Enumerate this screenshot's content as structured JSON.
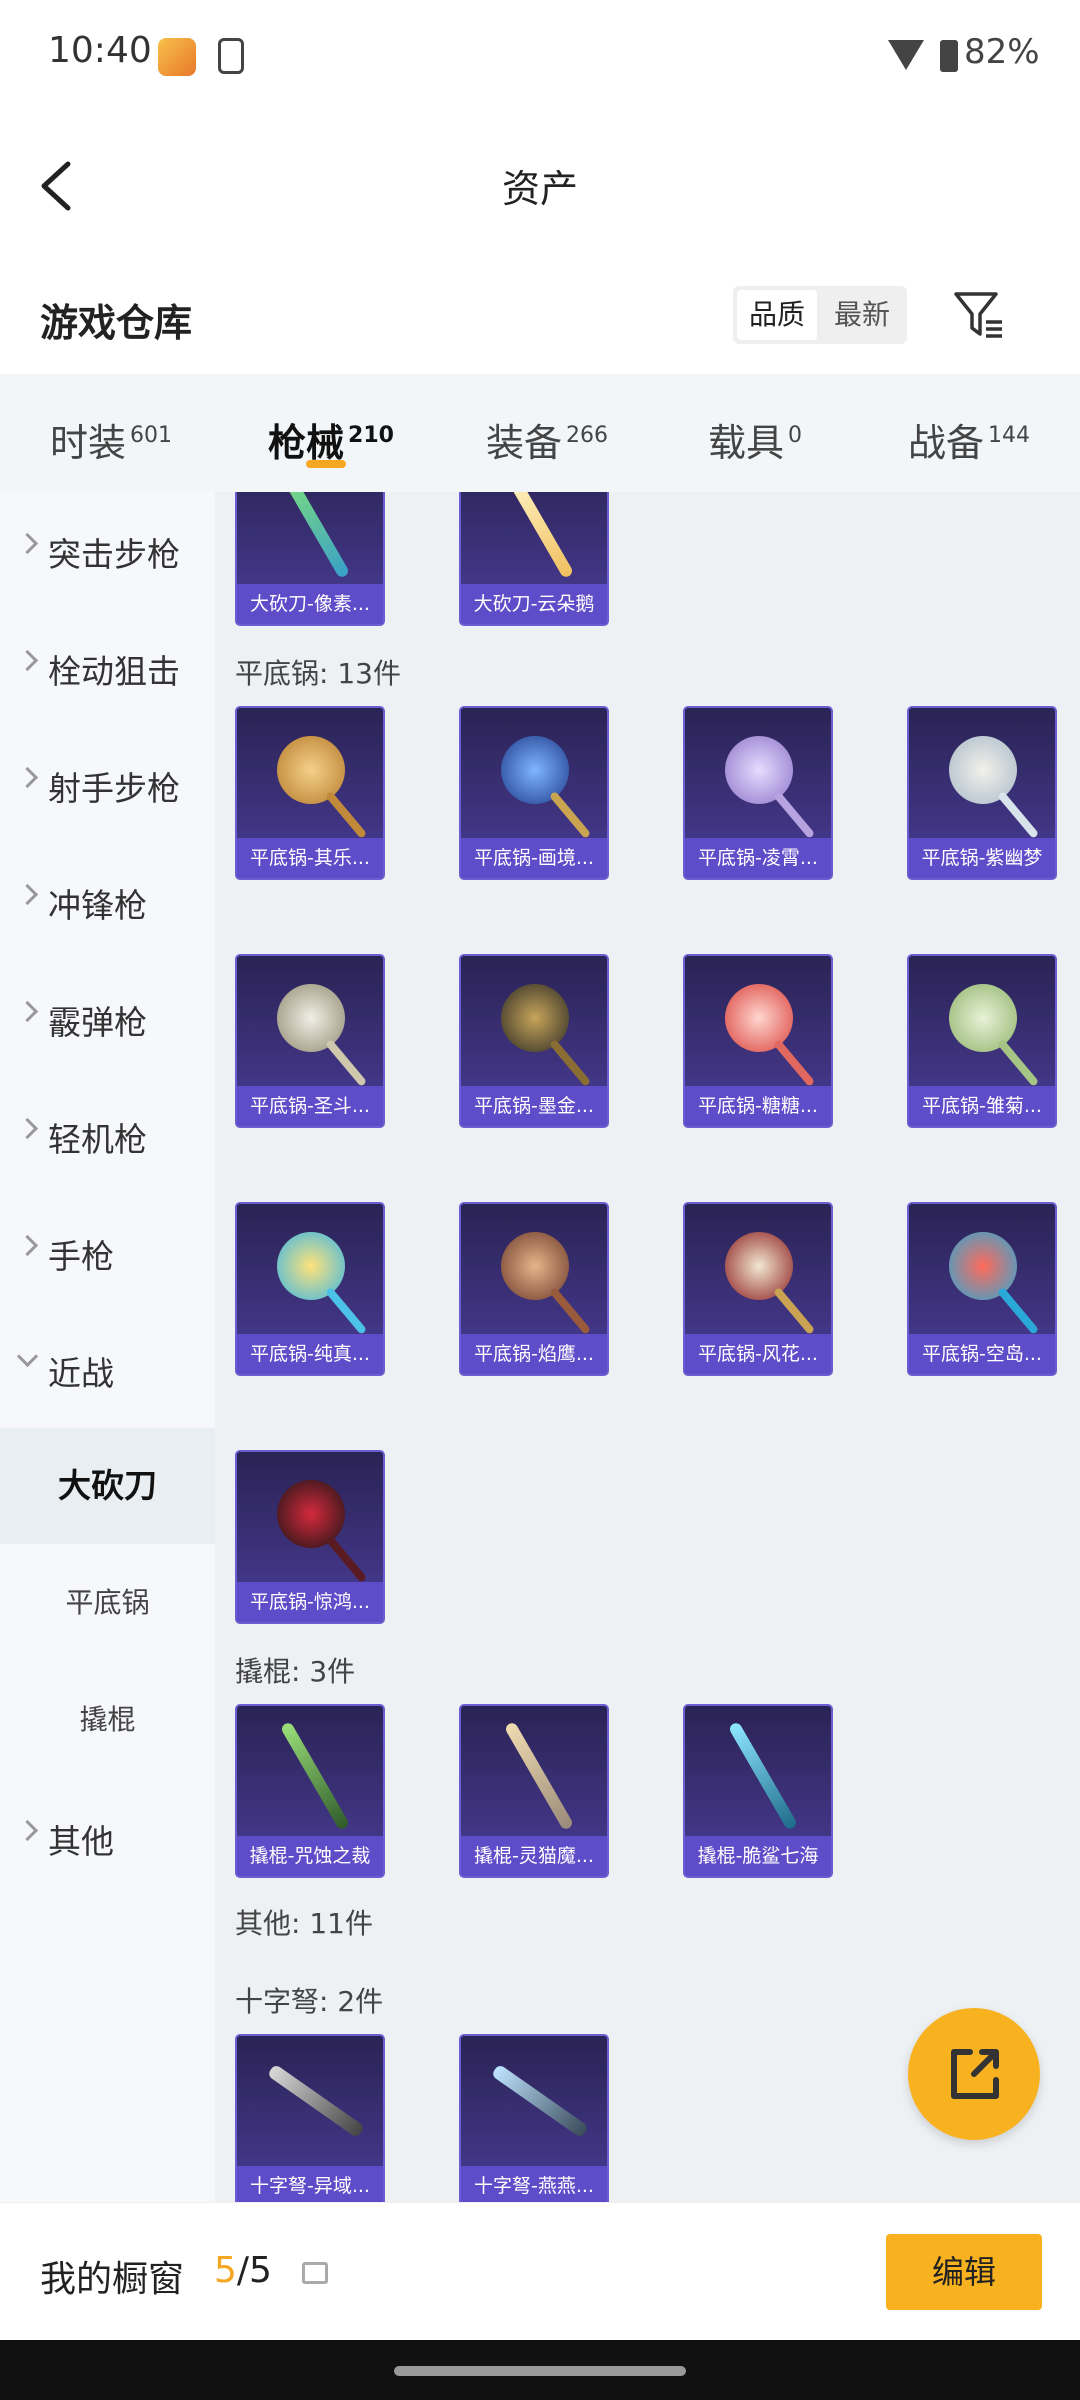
{
  "status_bar": {
    "time": "10:40",
    "battery": "82%"
  },
  "header": {
    "title": "资产"
  },
  "warehouse": {
    "title": "游戏仓库",
    "sort_quality": "品质",
    "sort_newest": "最新"
  },
  "tabs": [
    {
      "label": "时装",
      "count": "601"
    },
    {
      "label": "枪械",
      "count": "210"
    },
    {
      "label": "装备",
      "count": "266"
    },
    {
      "label": "载具",
      "count": "0"
    },
    {
      "label": "战备",
      "count": "144"
    }
  ],
  "sidebar": {
    "categories": [
      "突击步枪",
      "栓动狙击",
      "射手步枪",
      "冲锋枪",
      "霰弹枪",
      "轻机枪",
      "手枪",
      "近战"
    ],
    "subcategories": [
      "大砍刀",
      "平底锅",
      "撬棍"
    ],
    "other": "其他"
  },
  "groups": {
    "machete_items": [
      "大砍刀-像素...",
      "大砍刀-云朵鹅"
    ],
    "pan_label": "平底锅: 13件",
    "pan_items": [
      "平底锅-其乐...",
      "平底锅-画境...",
      "平底锅-凌霄...",
      "平底锅-紫幽梦",
      "平底锅-圣斗...",
      "平底锅-墨金...",
      "平底锅-糖糖...",
      "平底锅-雏菊...",
      "平底锅-纯真...",
      "平底锅-焰鹰...",
      "平底锅-风花...",
      "平底锅-空岛...",
      "平底锅-惊鸿..."
    ],
    "crowbar_label": "撬棍: 3件",
    "crowbar_items": [
      "撬棍-咒蚀之裁",
      "撬棍-灵猫魔...",
      "撬棍-脆鲨七海"
    ],
    "other_label": "其他: 11件",
    "crossbow_label": "十字弩: 2件",
    "crossbow_items": [
      "十字弩-异域...",
      "十字弩-燕燕..."
    ]
  },
  "bottom": {
    "my_window": "我的橱窗",
    "count_current": "5",
    "count_sep": "/",
    "count_total": "5",
    "edit": "编辑"
  },
  "colors": {
    "accent": "#f8b21f",
    "card_caption": "#5f4cc9"
  }
}
